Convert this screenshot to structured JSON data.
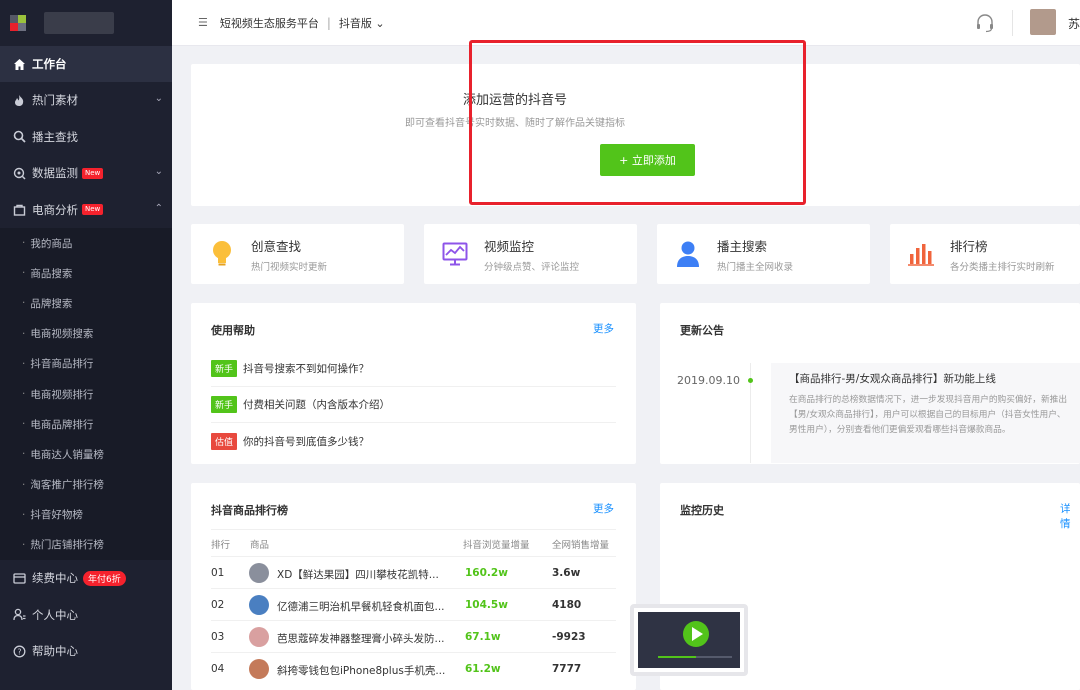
{
  "sidebar": {
    "main_items": [
      {
        "label": "工作台",
        "icon": "home-icon"
      },
      {
        "label": "热门素材",
        "icon": "fire-icon"
      },
      {
        "label": "播主查找",
        "icon": "search-icon"
      },
      {
        "label": "数据监测",
        "icon": "monitor-icon",
        "badge": "New"
      },
      {
        "label": "电商分析",
        "icon": "shop-icon",
        "badge": "New"
      }
    ],
    "sub_items": [
      "我的商品",
      "商品搜索",
      "品牌搜索",
      "电商视频搜索",
      "抖音商品排行",
      "电商视频排行",
      "电商品牌排行",
      "电商达人销量榜",
      "淘客推广排行榜",
      "抖音好物榜",
      "热门店铺排行榜"
    ],
    "bottom_items": [
      {
        "label": "续费中心",
        "icon": "card-icon",
        "badge": "年付6折"
      },
      {
        "label": "个人中心",
        "icon": "user-icon"
      },
      {
        "label": "帮助中心",
        "icon": "help-icon"
      }
    ]
  },
  "header": {
    "title": "短视频生态服务平台",
    "separator": "|",
    "version": "抖音版",
    "user": "苏"
  },
  "add_account": {
    "title": "添加运营的抖音号",
    "subtitle": "即可查看抖音号实时数据、随时了解作品关键指标",
    "button": "+ 立即添加"
  },
  "features": [
    {
      "title": "创意查找",
      "subtitle": "热门视频实时更新",
      "icon": "bulb-icon"
    },
    {
      "title": "视频监控",
      "subtitle": "分钟级点赞、评论监控",
      "icon": "chart-monitor-icon"
    },
    {
      "title": "播主搜索",
      "subtitle": "热门播主全网收录",
      "icon": "person-icon"
    },
    {
      "title": "排行榜",
      "subtitle": "各分类播主排行实时刷新",
      "icon": "bar-chart-icon"
    }
  ],
  "help": {
    "title": "使用帮助",
    "more": "更多",
    "items": [
      {
        "tag": "新手",
        "text": "抖音号搜索不到如何操作？"
      },
      {
        "tag": "新手",
        "text": "付费相关问题（内含版本介绍）"
      },
      {
        "tag": "估值",
        "text": "你的抖音号到底值多少钱？"
      }
    ]
  },
  "announcement": {
    "title": "更新公告",
    "date": "2019.09.10",
    "headline": "【商品排行-男/女观众商品排行】新功能上线",
    "body": "在商品排行的总榜数据情况下，进一步发现抖音用户的购买偏好，新推出【男/女观众商品排行】，用户可以根据自己的目标用户（抖音女性用户、男性用户），分别查看他们更偏爱观看哪些抖音爆款商品。"
  },
  "ranking": {
    "title": "抖音商品排行榜",
    "more": "更多",
    "columns": [
      "排行",
      "商品",
      "抖音浏览量增量",
      "全网销售增量"
    ],
    "rows": [
      {
        "rank": "01",
        "name": "XD【鲜达果园】四川攀枝花凯特...",
        "views": "160.2w",
        "sales": "3.6w"
      },
      {
        "rank": "02",
        "name": "亿德浦三明治机早餐机轻食机面包...",
        "views": "104.5w",
        "sales": "4180"
      },
      {
        "rank": "03",
        "name": "芭思蔻碎发神器整理膏小碎头发防...",
        "views": "67.1w",
        "sales": "-9923"
      },
      {
        "rank": "04",
        "name": "斜挎零钱包包iPhone8plus手机壳...",
        "views": "61.2w",
        "sales": "7777"
      }
    ]
  },
  "monitor_history": {
    "title": "监控历史",
    "more": "详情"
  },
  "colors": {
    "sidebar_bg": "#1e2130",
    "accent_green": "#52c41a",
    "link_blue": "#1890ff",
    "highlight_red": "#e8212c"
  }
}
